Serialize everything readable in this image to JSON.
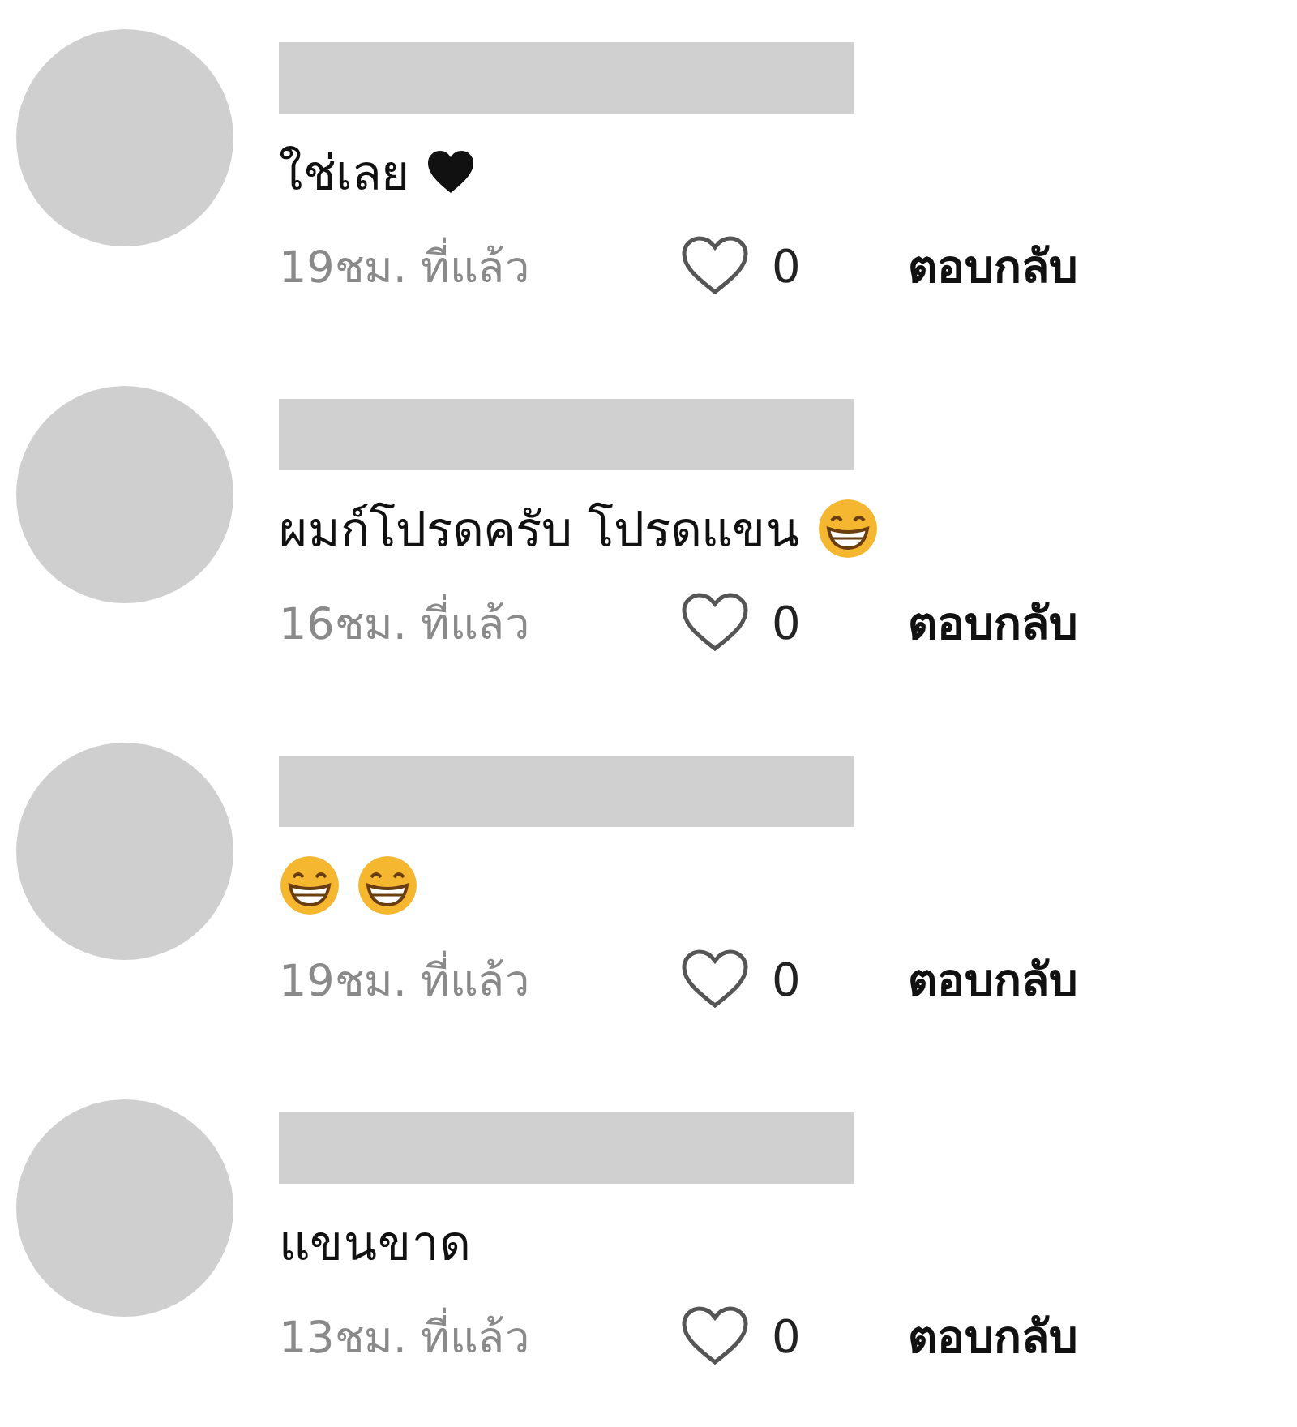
{
  "comments": [
    {
      "text": "ใช่เลย",
      "icons": [
        {
          "kind": "heart"
        }
      ],
      "time": "19ชม. ที่แล้ว",
      "likes": "0",
      "reply": "ตอบกลับ"
    },
    {
      "text": "ผมก์โปรดครับ โปรดแขน",
      "icons": [
        {
          "kind": "grin"
        }
      ],
      "time": "16ชม. ที่แล้ว",
      "likes": "0",
      "reply": "ตอบกลับ"
    },
    {
      "icons": [
        {
          "kind": "grin"
        },
        {
          "kind": "grin"
        }
      ],
      "time": "19ชม. ที่แล้ว",
      "likes": "0",
      "reply": "ตอบกลับ"
    },
    {
      "text": "แขนขาด",
      "time": "13ชม. ที่แล้ว",
      "likes": "0",
      "reply": "ตอบกลับ"
    }
  ]
}
